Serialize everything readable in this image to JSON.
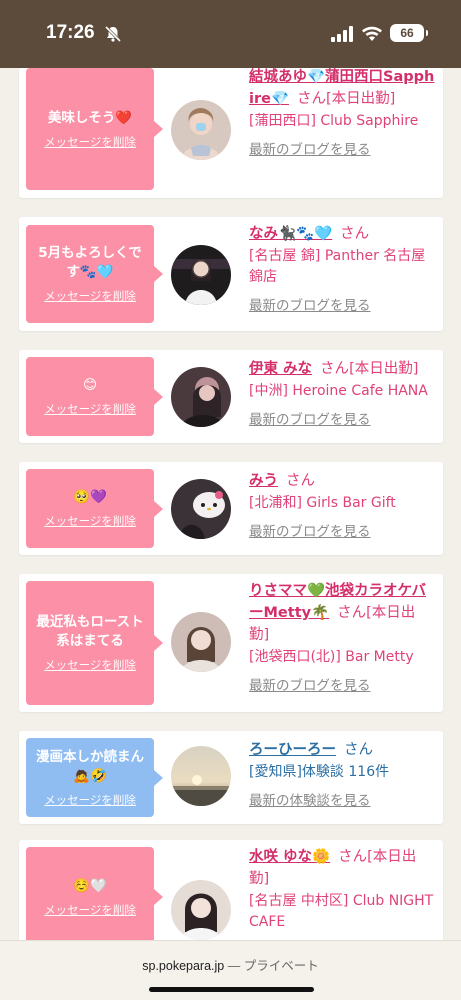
{
  "status_bar": {
    "time": "17:26",
    "battery": "66"
  },
  "items": [
    {
      "message": "美味しそう❤️",
      "delete_label": "メッセージを削除",
      "name": "結城あゆ💎蒲田西口Sapphire💎",
      "honorific": "さん",
      "tag": "[本日出勤]",
      "shop": "[蒲田西口] Club Sapphire",
      "link": "最新のブログを見る",
      "theme": "pink",
      "avatar_color": "#d8c9c0"
    },
    {
      "message": "5月もよろしくです🐾🩵",
      "delete_label": "メッセージを削除",
      "name": "なみ🐈‍⬛🐾🩵",
      "honorific": "さん",
      "tag": "",
      "shop": "[名古屋 錦] Panther 名古屋錦店",
      "link": "最新のブログを見る",
      "theme": "pink",
      "avatar_color": "#2a2a2a"
    },
    {
      "message": "😊",
      "delete_label": "メッセージを削除",
      "name": "伊東 みな",
      "honorific": "さん",
      "tag": "[本日出勤]",
      "shop": "[中洲] Heroine Cafe HANA",
      "link": "最新のブログを見る",
      "theme": "pink",
      "avatar_color": "#4a3a3e"
    },
    {
      "message": "🥺💜",
      "delete_label": "メッセージを削除",
      "name": "みう",
      "honorific": "さん",
      "tag": "",
      "shop": "[北浦和] Girls Bar Gift",
      "link": "最新のブログを見る",
      "theme": "pink",
      "avatar_color": "#3a3236"
    },
    {
      "message": "最近私もロースト系はまてる",
      "delete_label": "メッセージを削除",
      "name": "りさママ💚池袋カラオケバーMetty🌴",
      "honorific": "さん",
      "tag": "[本日出勤]",
      "shop": "[池袋西口(北)] Bar Metty",
      "link": "最新のブログを見る",
      "theme": "pink",
      "avatar_color": "#c9b6ad"
    },
    {
      "message": "漫画本しか読まん🙇🤣",
      "delete_label": "メッセージを削除",
      "name": "ろーひーろー",
      "honorific": "さん",
      "tag": "",
      "shop": "[愛知県]体験談 116件",
      "link": "最新の体験談を見る",
      "theme": "blue",
      "avatar_color": "#c9b48a"
    },
    {
      "message": "☺️🤍",
      "delete_label": "メッセージを削除",
      "name": "水咲 ゆな🌼",
      "honorific": "さん",
      "tag": "[本日出勤]",
      "shop": "[名古屋 中村区] Club NIGHT CAFE",
      "link": "最新のブログを見る",
      "theme": "pink",
      "avatar_color": "#e6dcd6"
    }
  ],
  "browser": {
    "url": "sp.pokepara.jp",
    "mode": "— プライベート"
  }
}
